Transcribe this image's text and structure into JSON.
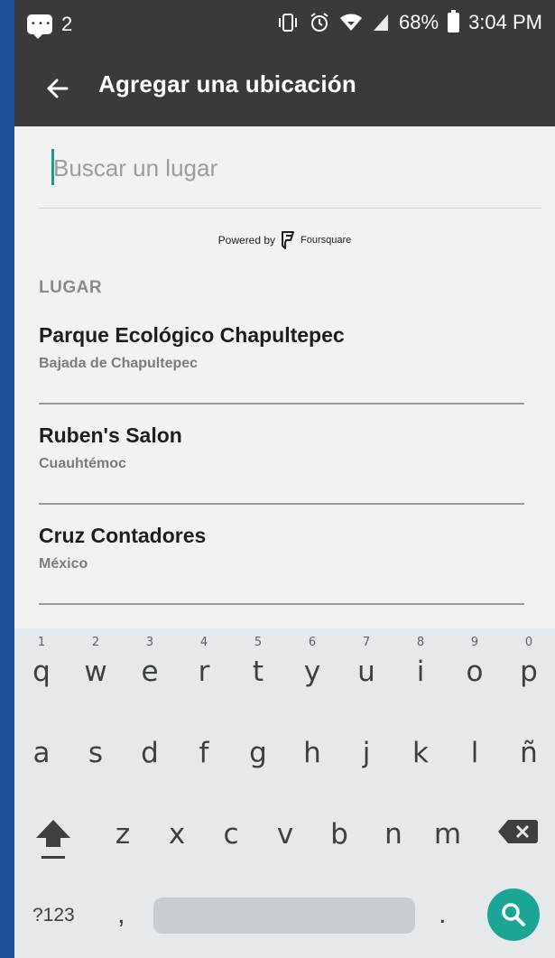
{
  "statusbar": {
    "notification_count": "2",
    "battery_pct": "68%",
    "time": "3:04 PM",
    "icons": [
      "message-icon",
      "vibrate-icon",
      "alarm-icon",
      "wifi-icon",
      "signal-icon",
      "battery-icon"
    ]
  },
  "appbar": {
    "title": "Agregar una ubicación",
    "back_icon": "arrow-left-icon"
  },
  "search": {
    "placeholder": "Buscar un lugar",
    "value": ""
  },
  "powered": {
    "prefix": "Powered by",
    "brand": "Foursquare"
  },
  "section_label": "LUGAR",
  "places": [
    {
      "name": "Parque Ecológico Chapultepec",
      "address": "Bajada de Chapultepec"
    },
    {
      "name": "Ruben's Salon",
      "address": "Cuauhtémoc"
    },
    {
      "name": "Cruz Contadores",
      "address": "México"
    }
  ],
  "keyboard": {
    "row1": [
      "q",
      "w",
      "e",
      "r",
      "t",
      "y",
      "u",
      "i",
      "o",
      "p"
    ],
    "row1_hints": [
      "1",
      "2",
      "3",
      "4",
      "5",
      "6",
      "7",
      "8",
      "9",
      "0"
    ],
    "row2": [
      "a",
      "s",
      "d",
      "f",
      "g",
      "h",
      "j",
      "k",
      "l",
      "ñ"
    ],
    "row3": [
      "z",
      "x",
      "c",
      "v",
      "b",
      "n",
      "m"
    ],
    "symbols_label": "?123",
    "comma": ",",
    "period": ".",
    "accent_color": "#1aa595"
  },
  "colors": {
    "appbar": "#3a3a3a",
    "caret": "#1a9b8c"
  }
}
